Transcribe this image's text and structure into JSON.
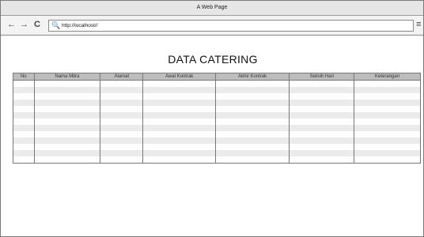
{
  "window": {
    "title": "A Web Page"
  },
  "toolbar": {
    "back_icon": "←",
    "forward_icon": "→",
    "reload_icon": "C",
    "search_icon": "🔍",
    "url": "http://localhost//",
    "menu_icon": "≡"
  },
  "page": {
    "heading": "DATA CATERING"
  },
  "table": {
    "columns": [
      "No",
      "Nama Mitra",
      "Alamat",
      "Awal Kontrak",
      "Akhir Kontrak",
      "Selisih Hari",
      "Keterangan"
    ],
    "row_count": 13
  }
}
